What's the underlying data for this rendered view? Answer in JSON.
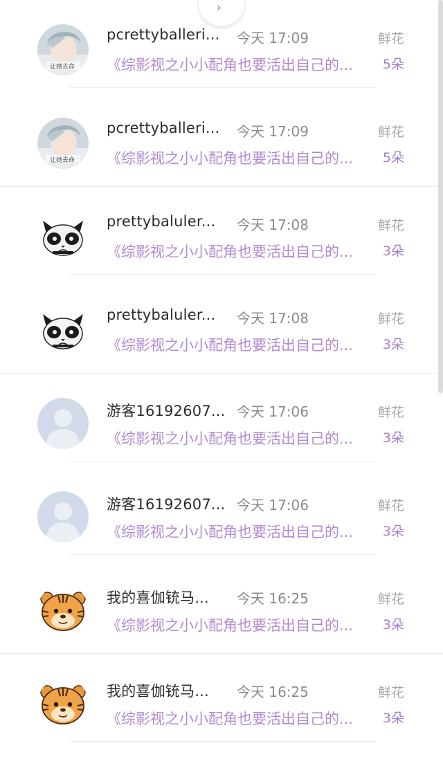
{
  "pull_indicator": "›",
  "rows": [
    {
      "name": "pcrettyballeri...",
      "time": "今天 17:09",
      "gift": "鲜花",
      "book": "《综影视之小小配角也要活出自己的...",
      "count": "5朵",
      "avatar": "photo-avatar"
    },
    {
      "name": "pcrettyballeri...",
      "time": "今天 17:09",
      "gift": "鲜花",
      "book": "《综影视之小小配角也要活出自己的...",
      "count": "5朵",
      "avatar": "photo-avatar"
    },
    {
      "name": "prettybaluler...",
      "time": "今天 17:08",
      "gift": "鲜花",
      "book": "《综影视之小小配角也要活出自己的...",
      "count": "3朵",
      "avatar": "panda-avatar"
    },
    {
      "name": "prettybaluler...",
      "time": "今天 17:08",
      "gift": "鲜花",
      "book": "《综影视之小小配角也要活出自己的...",
      "count": "3朵",
      "avatar": "panda-avatar"
    },
    {
      "name": "游客16192607...",
      "time": "今天 17:06",
      "gift": "鲜花",
      "book": "《综影视之小小配角也要活出自己的...",
      "count": "3朵",
      "avatar": "default-avatar"
    },
    {
      "name": "游客16192607...",
      "time": "今天 17:06",
      "gift": "鲜花",
      "book": "《综影视之小小配角也要活出自己的...",
      "count": "3朵",
      "avatar": "default-avatar"
    },
    {
      "name": "我的喜伽铳马...",
      "time": "今天 16:25",
      "gift": "鲜花",
      "book": "《综影视之小小配角也要活出自己的...",
      "count": "3朵",
      "avatar": "tiger-avatar"
    },
    {
      "name": "我的喜伽铳马...",
      "time": "今天 16:25",
      "gift": "鲜花",
      "book": "《综影视之小小配角也要活出自己的...",
      "count": "3朵",
      "avatar": "tiger-avatar"
    }
  ],
  "colors": {
    "name": "#2b2b2b",
    "time": "#8a8a8a",
    "gift_label": "#a8a8a8",
    "book_title": "#b18ad2",
    "count": "#a77fc9"
  }
}
